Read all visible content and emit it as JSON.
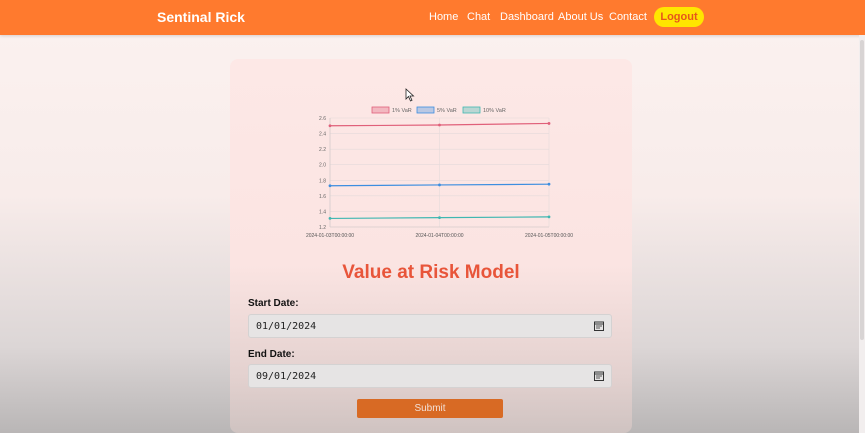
{
  "navbar": {
    "brand": "Sentinal Rick",
    "links": [
      "Home",
      "Chat",
      "Dashboard",
      "About Us",
      "Contact"
    ],
    "logout_label": "Logout"
  },
  "main": {
    "title": "Value at Risk Model",
    "start_label": "Start Date:",
    "start_value": "01/01/2024",
    "end_label": "End Date:",
    "end_value": "09/01/2024",
    "submit_label": "Submit"
  },
  "colors": {
    "navbar": "#ff7a2e",
    "logout_bg": "#ffe600",
    "title": "#e8553a",
    "submit_bg": "#d86a24"
  },
  "chart_data": {
    "type": "line",
    "x": [
      "2024-01-03T00:00:00",
      "2024-01-04T00:00:00",
      "2024-01-05T00:00:00"
    ],
    "series": [
      {
        "name": "1% VaR",
        "values": [
          2.5,
          2.51,
          2.53
        ],
        "color": "#e0607a"
      },
      {
        "name": "5% VaR",
        "values": [
          1.73,
          1.74,
          1.75
        ],
        "color": "#3c8ee0"
      },
      {
        "name": "10% VaR",
        "values": [
          1.31,
          1.32,
          1.33
        ],
        "color": "#3fb7b1"
      }
    ],
    "yticks": [
      "2.6",
      "2.4",
      "2.2",
      "2.0",
      "1.8",
      "1.6",
      "1.4",
      "1.2"
    ],
    "ylim": [
      1.2,
      2.6
    ],
    "grid": true,
    "legend": "top"
  }
}
